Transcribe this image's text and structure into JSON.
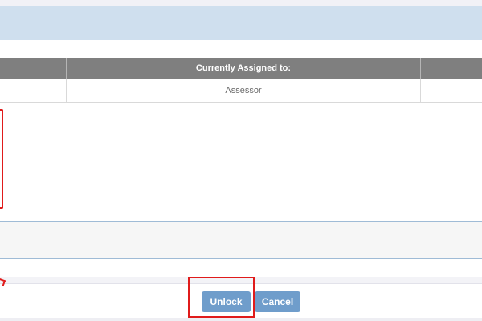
{
  "table": {
    "headers": [
      "",
      "Currently Assigned to:",
      ""
    ],
    "rows": [
      [
        "",
        "Assessor",
        ""
      ]
    ]
  },
  "buttons": {
    "unlock_label": "Unlock",
    "cancel_label": "Cancel"
  },
  "colors": {
    "header_band": "#cfdfee",
    "table_header": "#7f7f7f",
    "button": "#6f9dcb",
    "highlight": "#e01b1b"
  }
}
